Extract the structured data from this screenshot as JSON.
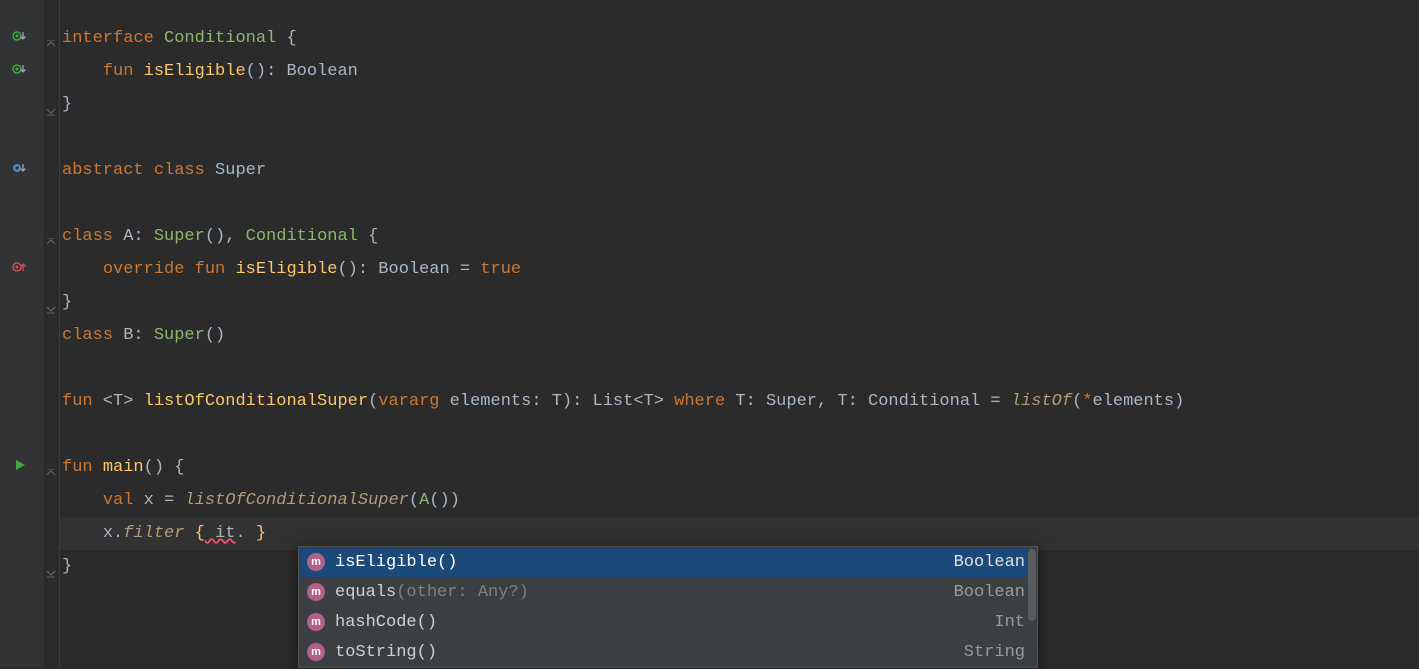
{
  "code": {
    "l1": {
      "kw1": "interface",
      "name": "Conditional",
      "open": " {"
    },
    "l2": {
      "indent": "    ",
      "kw": "fun",
      "fn": "isEligible",
      "parens": "()",
      "colon": ": ",
      "ret": "Boolean"
    },
    "l3": {
      "close": "}"
    },
    "l5": {
      "kw1": "abstract",
      "kw2": "class",
      "name": "Super"
    },
    "l7": {
      "kw": "class",
      "name": "A",
      "colon": ": ",
      "sup": "Super",
      "supcall": "()",
      "comma": ", ",
      "iface": "Conditional",
      "open": " {"
    },
    "l8": {
      "indent": "    ",
      "kw1": "override",
      "kw2": "fun",
      "fn": "isEligible",
      "parens": "()",
      "colon": ": ",
      "ret": "Boolean",
      "eq": " = ",
      "val": "true"
    },
    "l9": {
      "close": "}"
    },
    "l10": {
      "kw": "class",
      "name": "B",
      "colon": ": ",
      "sup": "Super",
      "supcall": "()"
    },
    "l12": {
      "kw": "fun",
      "tparam_open": " <",
      "tparam": "T",
      "tparam_close": "> ",
      "fn": "listOfConditionalSuper",
      "popen": "(",
      "vararg": "vararg",
      "pname": " elements",
      "pcolon": ": ",
      "ptype": "T",
      "pclose": ")",
      "rcolon": ": ",
      "rtype": "List",
      "rt_open": "<",
      "rt_t": "T",
      "rt_close": ">",
      "where": " where ",
      "t1": "T",
      "c1": ": ",
      "b1": "Super",
      "comma": ", ",
      "t2": "T",
      "c2": ": ",
      "b2": "Conditional",
      "eq": " = ",
      "call": "listOf",
      "copen": "(",
      "spread": "*",
      "arg": "elements",
      "cclose": ")"
    },
    "l14": {
      "kw": "fun",
      "fn": "main",
      "parens": "()",
      "open": " {"
    },
    "l15": {
      "indent": "    ",
      "kw": "val",
      "name": " x ",
      "eq": "= ",
      "call": "listOfConditionalSuper",
      "copen": "(",
      "arg": "A",
      "argcall": "()",
      "cclose": ")"
    },
    "l16": {
      "indent": "    ",
      "recv": "x",
      "dot": ".",
      "call": "filter",
      "space": " ",
      "lb": "{",
      "it": " it",
      "dot2": ".",
      "sp2": " ",
      "rb": "}"
    },
    "l17": {
      "close": "}"
    }
  },
  "completion": {
    "items": [
      {
        "label": "isEligible",
        "params": "()",
        "hint": "",
        "type": "Boolean",
        "selected": true
      },
      {
        "label": "equals",
        "params": "",
        "hint": "(other: Any?)",
        "type": "Boolean",
        "selected": false
      },
      {
        "label": "hashCode",
        "params": "()",
        "hint": "",
        "type": "Int",
        "selected": false
      },
      {
        "label": "toString",
        "params": "()",
        "hint": "",
        "type": "String",
        "selected": false
      }
    ]
  },
  "icons": {
    "m": "m"
  }
}
